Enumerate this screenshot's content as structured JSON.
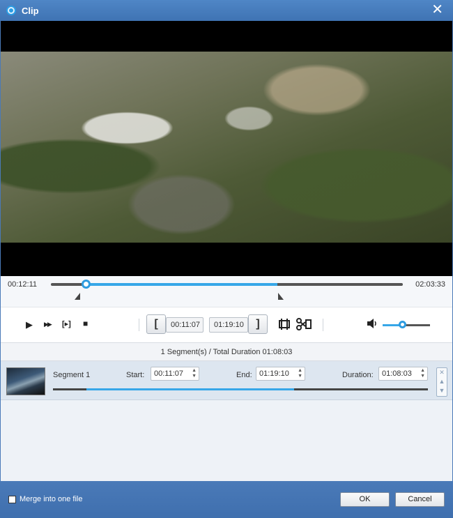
{
  "window": {
    "title": "Clip",
    "close_glyph": "✕"
  },
  "timeline": {
    "current_time": "00:12:11",
    "total_time": "02:03:33",
    "position_fraction": 0.1
  },
  "controls": {
    "play_glyph": "▶",
    "fast_forward_glyph": "▶▶",
    "play_selection_glyph": "[▸]",
    "stop_glyph": "■",
    "set_start_glyph": "[",
    "set_end_glyph": "]",
    "start_time": "00:11:07",
    "end_time": "01:19:10",
    "volume_glyph": "🔊",
    "volume_fraction": 0.42
  },
  "summary": "1 Segment(s) / Total Duration 01:08:03",
  "segments": [
    {
      "name": "Segment 1",
      "start_label": "Start:",
      "start": "00:11:07",
      "end_label": "End:",
      "end": "01:19:10",
      "duration_label": "Duration:",
      "duration": "01:08:03"
    }
  ],
  "footer": {
    "merge_label": "Merge into one file",
    "merge_checked": false,
    "ok_label": "OK",
    "cancel_label": "Cancel"
  },
  "colors": {
    "accent": "#37a7e8",
    "titlebar": "#4a7ab8"
  }
}
